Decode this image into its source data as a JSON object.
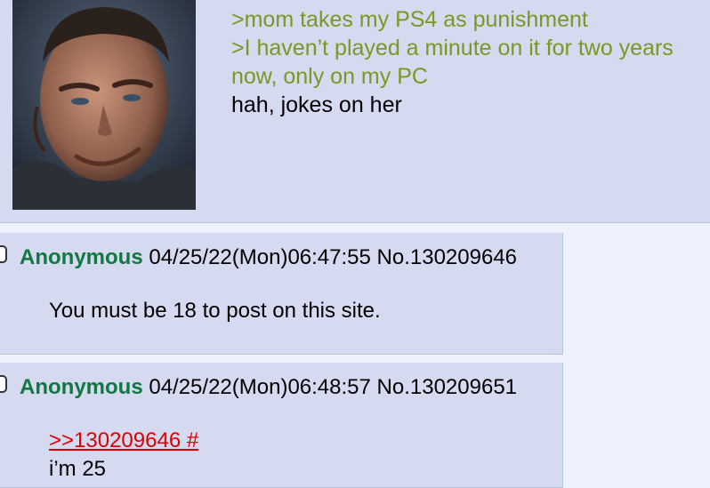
{
  "op": {
    "image_alt": "smirking man avatar",
    "lines": [
      {
        "text": ">mom takes my PS4 as punishment",
        "greentext": true
      },
      {
        "text": ">I haven’t played a minute on it for two years now, only on my PC",
        "greentext": true
      },
      {
        "text": "hah, jokes on her",
        "greentext": false
      }
    ]
  },
  "replies": [
    {
      "name": "Anonymous",
      "datetime": "04/25/22(Mon)06:47:55",
      "post_no": "No.130209646",
      "quote": "",
      "message": "You must be 18 to post on this site."
    },
    {
      "name": "Anonymous",
      "datetime": "04/25/22(Mon)06:48:57",
      "post_no": "No.130209651",
      "quote": ">>130209646 #",
      "message": "i’m 25"
    }
  ],
  "colors": {
    "post_bg": "#d6daf0",
    "page_bg": "#eef2ff",
    "greentext": "#789922",
    "name": "#117743",
    "quotelink": "#dd0000"
  }
}
